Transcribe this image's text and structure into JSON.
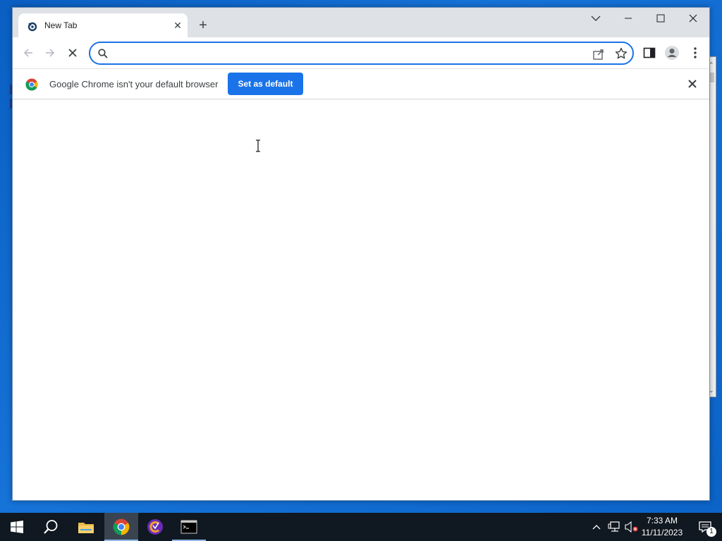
{
  "browser": {
    "tab": {
      "title": "New Tab"
    },
    "omnibox": {
      "value": "",
      "placeholder": ""
    },
    "infobar": {
      "message": "Google Chrome isn't your default browser",
      "button_label": "Set as default"
    }
  },
  "taskbar": {
    "clock": {
      "time": "7:33 AM",
      "date": "11/11/2023"
    },
    "notification_count": "1",
    "apps": [
      "start-icon",
      "search-icon",
      "file-explorer-icon",
      "chrome-icon",
      "ccleaner-icon",
      "command-prompt-icon"
    ]
  },
  "colors": {
    "accent": "#1a73e8",
    "desktop": "#0b63c8",
    "taskbar": "#101821",
    "titlebar": "#dee1e6"
  }
}
